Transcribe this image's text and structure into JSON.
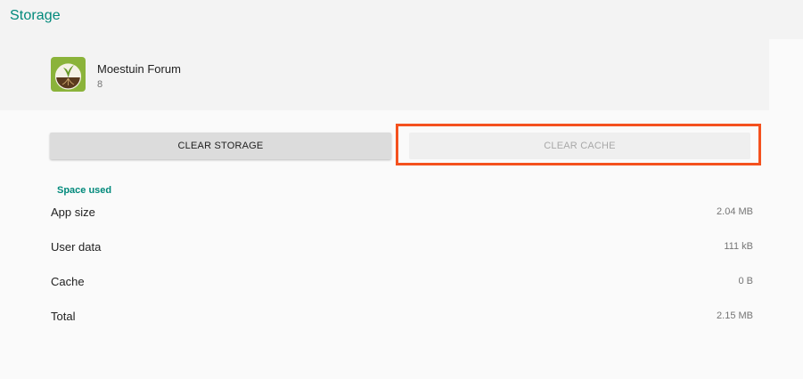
{
  "header": {
    "title": "Storage"
  },
  "app": {
    "name": "Moestuin Forum",
    "version": "8",
    "icon": "moestuin-forum-app-icon"
  },
  "buttons": {
    "clear_storage": "CLEAR STORAGE",
    "clear_cache": "CLEAR CACHE"
  },
  "space_used": {
    "header": "Space used",
    "rows": [
      {
        "label": "App size",
        "value": "2.04 MB"
      },
      {
        "label": "User data",
        "value": "111 kB"
      },
      {
        "label": "Cache",
        "value": "0 B"
      },
      {
        "label": "Total",
        "value": "2.15 MB"
      }
    ]
  },
  "colors": {
    "accent": "#00897b",
    "highlight": "#f4511e"
  }
}
